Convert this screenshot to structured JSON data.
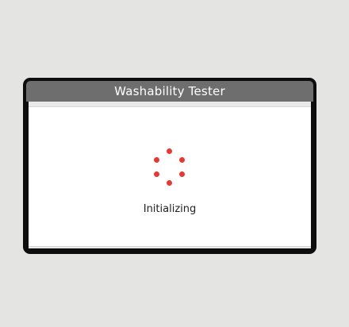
{
  "window": {
    "title": "Washability Tester"
  },
  "loader": {
    "status_text": "Initializing",
    "dot_color": "#e53935",
    "icon": "loading-spinner-icon"
  },
  "colors": {
    "background": "#e4e5e3",
    "bezel": "#0d0d0d",
    "title_bar": "#6e6e6e",
    "content": "#ffffff"
  }
}
